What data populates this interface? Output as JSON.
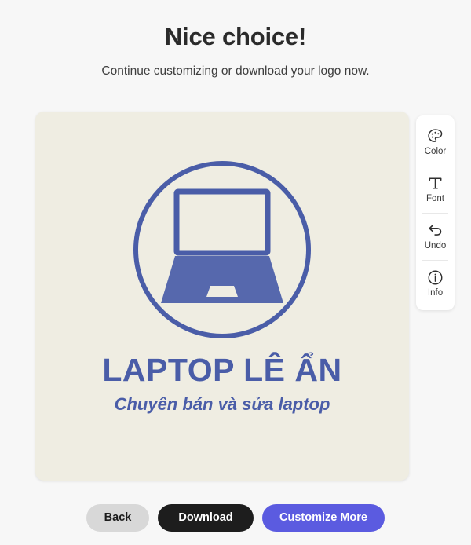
{
  "header": {
    "title": "Nice choice!",
    "subtitle": "Continue customizing or download your logo now."
  },
  "logo": {
    "name": "LAPTOP LÊ ẨN",
    "tagline": "Chuyên bán và sửa laptop",
    "icon_name": "laptop-in-circle-icon",
    "colors": {
      "canvas_background": "#efede2",
      "mark": "#4a5da8",
      "mark_fill": "#5668ad",
      "text": "#4a5da8"
    }
  },
  "toolbar": {
    "items": [
      {
        "label": "Color",
        "icon": "palette-icon"
      },
      {
        "label": "Font",
        "icon": "text-t-icon"
      },
      {
        "label": "Undo",
        "icon": "undo-arrow-icon"
      },
      {
        "label": "Info",
        "icon": "info-circle-icon"
      }
    ]
  },
  "actions": {
    "back": "Back",
    "download": "Download",
    "customize": "Customize More",
    "colors": {
      "back": "#d8d8d8",
      "download": "#1d1d1d",
      "customize": "#5b5be0"
    }
  },
  "page": {
    "background": "#f7f7f7"
  }
}
